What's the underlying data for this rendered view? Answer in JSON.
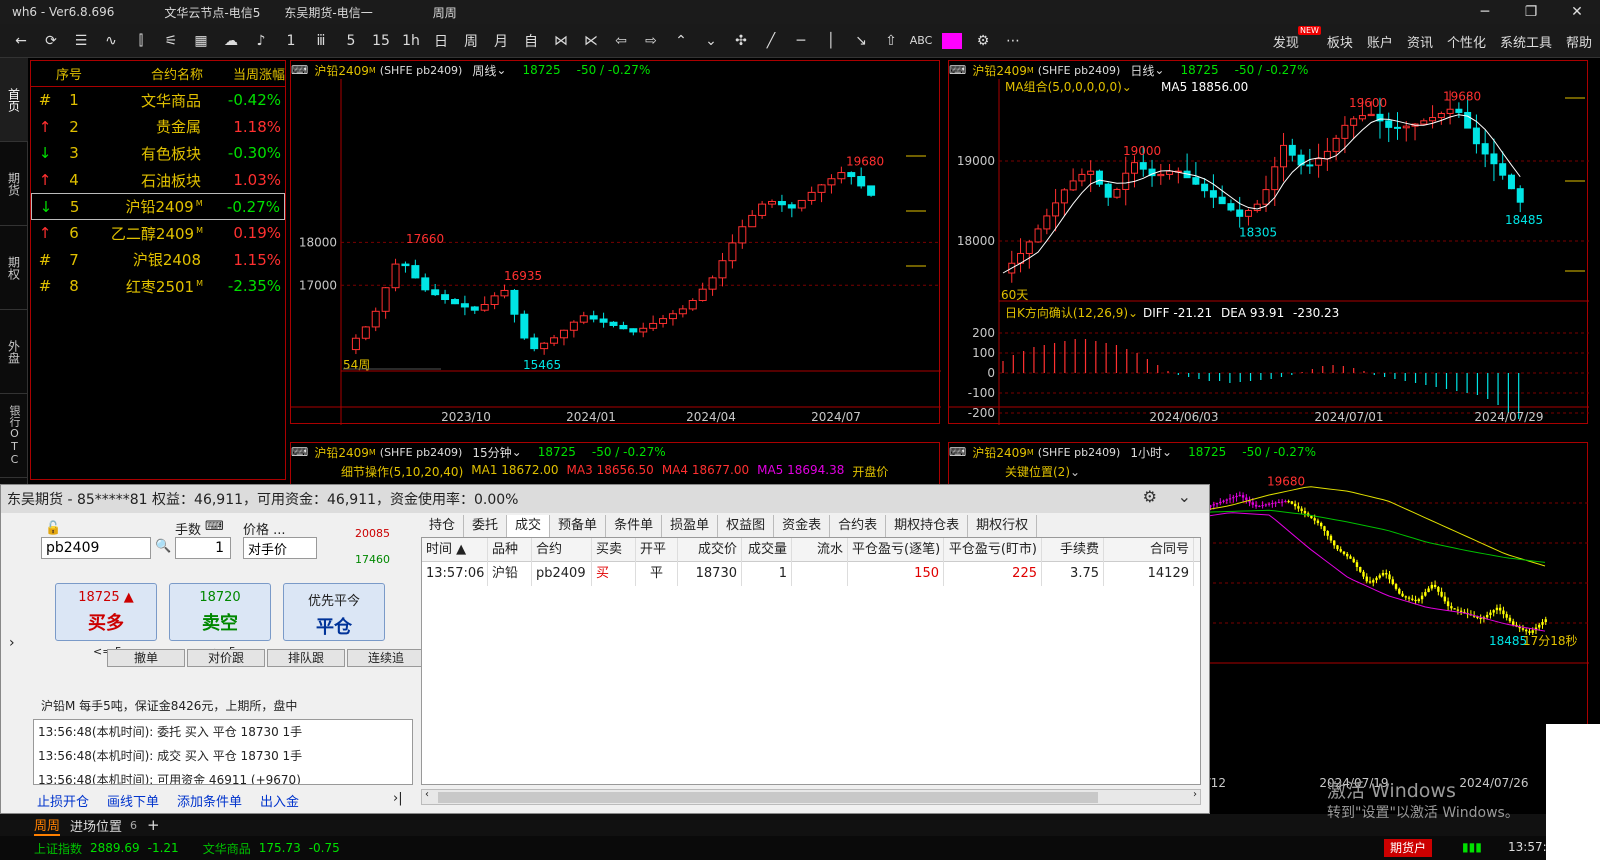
{
  "titlebar": {
    "app": "wh6 - Ver6.8.696",
    "node": "文华云节点-电信5",
    "broker": "东吴期货-电信一",
    "period": "周周",
    "min": "─",
    "max": "❐",
    "close": "✕"
  },
  "toolbar": {
    "icons": [
      "back-icon",
      "refresh-icon",
      "list-icon",
      "line-chart-icon",
      "candle-icon",
      "split-icon",
      "table-icon",
      "cloud-icon",
      "bell-icon"
    ],
    "periods": [
      "1",
      "5",
      "15",
      "1h",
      "日",
      "周",
      "月",
      "自"
    ],
    "menu": [
      "发现",
      "板块",
      "账户",
      "资讯",
      "个性化",
      "系统工具",
      "帮助"
    ],
    "new_badge": "NEW",
    "abc": "ABC"
  },
  "sidebar": [
    "首页",
    "期货",
    "期权",
    "外盘",
    "银行OTC"
  ],
  "rank": {
    "headers": [
      "序号",
      "合约名称",
      "当周涨幅"
    ],
    "rows": [
      {
        "mark": "#",
        "idx": "1",
        "name": "文华商品",
        "chg": "-0.42%",
        "up": false,
        "sup": ""
      },
      {
        "mark": "↑",
        "idx": "2",
        "name": "贵金属",
        "chg": "1.18%",
        "up": true,
        "sup": ""
      },
      {
        "mark": "↓",
        "idx": "3",
        "name": "有色板块",
        "chg": "-0.30%",
        "up": false,
        "sup": ""
      },
      {
        "mark": "↑",
        "idx": "4",
        "name": "石油板块",
        "chg": "1.03%",
        "up": true,
        "sup": ""
      },
      {
        "mark": "↓",
        "idx": "5",
        "name": "沪铅2409",
        "chg": "-0.27%",
        "up": false,
        "sup": "M"
      },
      {
        "mark": "↑",
        "idx": "6",
        "name": "乙二醇2409",
        "chg": "0.19%",
        "up": true,
        "sup": "M"
      },
      {
        "mark": "#",
        "idx": "7",
        "name": "沪银2408",
        "chg": "1.15%",
        "up": true,
        "sup": ""
      },
      {
        "mark": "#",
        "idx": "8",
        "name": "红枣2501",
        "chg": "-2.35%",
        "up": false,
        "sup": "M"
      }
    ]
  },
  "weekly": {
    "title": "沪铅2409",
    "sup": "M",
    "code": "(SHFE pb2409)",
    "period": "周线",
    "price": "18725",
    "change": "-50 / -0.27%",
    "ylabels": [
      "18000",
      "17000"
    ],
    "xlabels": [
      "2023/10",
      "2024/01",
      "2024/04",
      "2024/07"
    ],
    "peaks": [
      "19680",
      "17660",
      "16935",
      "15465"
    ],
    "bars": "54周"
  },
  "daily": {
    "title": "沪铅2409",
    "sup": "M",
    "code": "(SHFE pb2409)",
    "period": "日线",
    "price": "18725",
    "change": "-50 / -0.27%",
    "ma_label": "MA组合(5,0,0,0,0,0)",
    "ma5": "MA5 18856.00",
    "ylabels": [
      "19000",
      "18000"
    ],
    "peaks": [
      "19600",
      "19680",
      "19000",
      "18305",
      "18485"
    ],
    "bars": "60天",
    "macd_label": "日K方向确认(12,26,9)",
    "diff": "DIFF -21.21",
    "dea": "DEA 93.91",
    "macd": "-230.23",
    "macd_y": [
      "200",
      "100",
      "0",
      "-100",
      "-200"
    ],
    "xlabels": [
      "2024/06/03",
      "2024/07/01",
      "2024/07/29"
    ]
  },
  "m15": {
    "title": "沪铅2409",
    "sup": "M",
    "code": "(SHFE pb2409)",
    "period": "15分钟",
    "price": "18725",
    "change": "-50 / -0.27%",
    "sub": "细节操作(5,10,20,40)",
    "ma1": "MA1 18672.00",
    "ma3": "MA3 18656.50",
    "ma4": "MA4 18677.00",
    "ma5": "MA5 18694.38",
    "open": "开盘价"
  },
  "h1": {
    "title": "沪铅2409",
    "sup": "M",
    "code": "(SHFE pb2409)",
    "period": "1小时",
    "price": "18725",
    "change": "-50 / -0.27%",
    "sub": "关键位置(2)",
    "peak": "19680",
    "low": "18485",
    "timer": "17分18秒",
    "xlabels": [
      "7/12",
      "2024/07/19",
      "2024/07/26"
    ]
  },
  "trade": {
    "title": "东吴期货 - 85*****81 权益：46,911，可用资金：46,911，资金使用率：0.00%",
    "contract": "pb2409",
    "qty_label": "手数",
    "qty": "1",
    "price_label": "价格 ...",
    "price_mode": "对手价",
    "upper": "20085",
    "lower": "17460",
    "buy": {
      "price": "18725",
      "label": "买多",
      "limit": "<= 5"
    },
    "sell": {
      "price": "18720",
      "label": "卖空",
      "limit": "<= 5"
    },
    "close": {
      "top": "优先平今",
      "label": "平仓"
    },
    "small": [
      "撤单",
      "对价跟",
      "排队跟",
      "连续追"
    ],
    "info": "沪铅M 每手5吨，保证金8426元，上期所，盘中",
    "log": [
      "13:56:48(本机时间): 委托  买入  平仓  18730  1手",
      "13:56:48(本机时间): 成交  买入  平仓  18730  1手",
      "13:56:48(本机时间): 可用资金 46911 (+9670)"
    ],
    "links": [
      "止损开仓",
      "画线下单",
      "添加条件单",
      "出入金"
    ],
    "tabs": [
      "持仓",
      "委托",
      "成交",
      "预备单",
      "条件单",
      "损盈单",
      "权益图",
      "资金表",
      "合约表",
      "期权持仓表",
      "期权行权"
    ],
    "cols": [
      "时间 ▲",
      "品种",
      "合约",
      "买卖",
      "开平",
      "成交价",
      "成交量",
      "流水",
      "平仓盈亏(逐笔)",
      "平仓盈亏(盯市)",
      "手续费",
      "合同号"
    ],
    "row": [
      "13:57:06",
      "沪铅",
      "pb2409",
      "买",
      "平",
      "18730",
      "1",
      "",
      "150",
      "225",
      "3.75",
      "14129"
    ]
  },
  "bottom": {
    "tab1": "周周",
    "tab2": "进场位置",
    "tab2_count": "6",
    "plus": "+"
  },
  "status": {
    "idx": "上证指数",
    "idx_val": "2889.69",
    "idx_chg": "-1.21",
    "wh": "文华商品",
    "wh_val": "175.73",
    "wh_chg": "-0.75",
    "account": "期货户",
    "time": "13:57:"
  },
  "watermark": {
    "line1": "激活 Windows",
    "line2": "转到\"设置\"以激活 Windows。"
  },
  "colors": {
    "up": "#ff3030",
    "down": "#00e000",
    "cyan": "#00e5e5",
    "yellow": "#e0c000",
    "border": "#a00000"
  }
}
